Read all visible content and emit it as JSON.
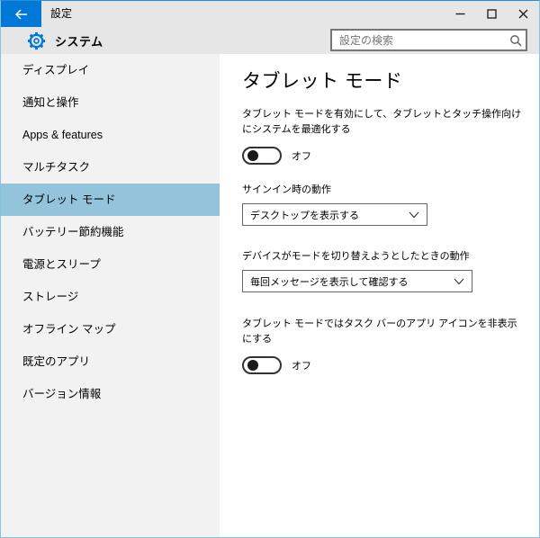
{
  "titlebar": {
    "title": "設定"
  },
  "header": {
    "app_section": "システム",
    "search_placeholder": "設定の検索"
  },
  "sidebar": {
    "items": [
      {
        "label": "ディスプレイ",
        "selected": false
      },
      {
        "label": "通知と操作",
        "selected": false
      },
      {
        "label": "Apps & features",
        "selected": false
      },
      {
        "label": "マルチタスク",
        "selected": false
      },
      {
        "label": "タブレット モード",
        "selected": true
      },
      {
        "label": "バッテリー節約機能",
        "selected": false
      },
      {
        "label": "電源とスリープ",
        "selected": false
      },
      {
        "label": "ストレージ",
        "selected": false
      },
      {
        "label": "オフライン マップ",
        "selected": false
      },
      {
        "label": "既定のアプリ",
        "selected": false
      },
      {
        "label": "バージョン情報",
        "selected": false
      }
    ]
  },
  "main": {
    "title": "タブレット モード",
    "tablet_mode_toggle": {
      "description": "タブレット モードを有効にして、タブレットとタッチ操作向けにシステムを最適化する",
      "state": "off",
      "state_label": "オフ"
    },
    "signin_behavior": {
      "label": "サインイン時の動作",
      "selected_option": "デスクトップを表示する"
    },
    "mode_switch_behavior": {
      "label": "デバイスがモードを切り替えようとしたときの動作",
      "selected_option": "毎回メッセージを表示して確認する"
    },
    "hide_taskbar_icons_toggle": {
      "description": "タブレット モードではタスク バーのアプリ アイコンを非表示にする",
      "state": "off",
      "state_label": "オフ"
    }
  },
  "colors": {
    "accent": "#0078d7",
    "selected_nav_bg": "#94c4dc",
    "chrome_bg": "#e6e6e6",
    "sidebar_bg": "#f2f2f2"
  }
}
